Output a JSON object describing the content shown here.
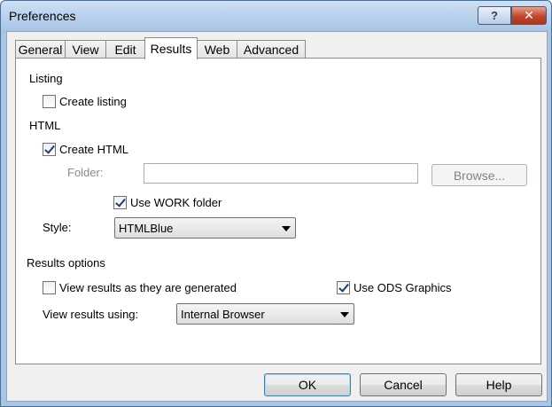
{
  "window": {
    "title": "Preferences"
  },
  "caption_buttons": {
    "help": "?",
    "close": "✕"
  },
  "tabs": [
    {
      "label": "General"
    },
    {
      "label": "View"
    },
    {
      "label": "Edit"
    },
    {
      "label": "Results",
      "active": true
    },
    {
      "label": "Web"
    },
    {
      "label": "Advanced"
    }
  ],
  "listing": {
    "group_label": "Listing",
    "create_listing": {
      "label": "Create listing",
      "checked": false
    }
  },
  "html": {
    "group_label": "HTML",
    "create_html": {
      "label": "Create HTML",
      "checked": true
    },
    "folder": {
      "label": "Folder:",
      "value": ""
    },
    "browse_label": "Browse...",
    "use_work_folder": {
      "label": "Use WORK folder",
      "checked": true
    },
    "style": {
      "label": "Style:",
      "value": "HTMLBlue"
    }
  },
  "results_options": {
    "group_label": "Results options",
    "view_as_generated": {
      "label": "View results as they are generated",
      "checked": false
    },
    "use_ods_graphics": {
      "label": "Use ODS Graphics",
      "checked": true
    },
    "view_using": {
      "label": "View results using:",
      "value": "Internal Browser"
    }
  },
  "footer": {
    "ok": "OK",
    "cancel": "Cancel",
    "help": "Help"
  },
  "colors": {
    "title_bar": "#b7d0ec",
    "close_button": "#c2462c",
    "dialog_bg": "#f0f0f0"
  }
}
